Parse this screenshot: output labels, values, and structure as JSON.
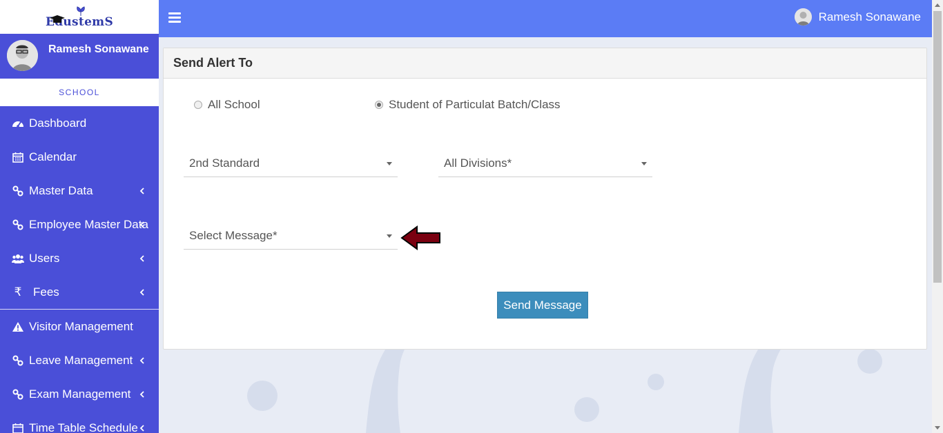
{
  "app": {
    "logo_text": "EdustemS"
  },
  "sidebar": {
    "user_name": "Ramesh Sonawane",
    "section_label": "SCHOOL",
    "items": [
      {
        "label": "Dashboard",
        "icon": "dashboard-icon",
        "has_submenu": false
      },
      {
        "label": "Calendar",
        "icon": "calendar-icon",
        "has_submenu": false
      },
      {
        "label": "Master Data",
        "icon": "link-icon",
        "has_submenu": true
      },
      {
        "label": "Employee Master Data",
        "icon": "link-icon",
        "has_submenu": true
      },
      {
        "label": "Users",
        "icon": "users-icon",
        "has_submenu": true
      },
      {
        "label": "Fees",
        "icon": "rupee-icon",
        "has_submenu": true
      },
      {
        "label": "Visitor Management",
        "icon": "warning-icon",
        "has_submenu": false
      },
      {
        "label": "Leave Management",
        "icon": "link-icon",
        "has_submenu": true
      },
      {
        "label": "Exam Management",
        "icon": "link-icon",
        "has_submenu": true
      },
      {
        "label": "Time Table Schedule",
        "icon": "calendar-icon",
        "has_submenu": true
      }
    ]
  },
  "header": {
    "user_name": "Ramesh Sonawane"
  },
  "form": {
    "title": "Send Alert To",
    "radio_all_school": "All School",
    "radio_student_batch": "Student of Particulat Batch/Class",
    "selected_radio": "student_batch",
    "standard_select": "2nd Standard",
    "division_select": "All Divisions*",
    "message_select": "Select Message*",
    "send_button": "Send Message"
  },
  "colors": {
    "sidebar_bg": "#4a4fd8",
    "header_bg": "#5b7cf5",
    "button_bg": "#3c8dbc",
    "pointer_arrow": "#7a0010"
  }
}
